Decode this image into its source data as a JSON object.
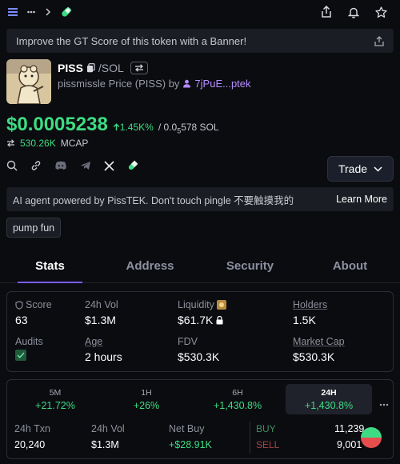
{
  "header": {
    "icons": [
      "menu-icon",
      "more-icon",
      "chevron-right-icon",
      "pill-icon",
      "share-icon",
      "bell-icon",
      "star-icon"
    ]
  },
  "banner": {
    "text": "Improve the GT Score of this token with a Banner!"
  },
  "token": {
    "symbol": "PISS",
    "pair": "/SOL",
    "subtitle": "pissmissle Price (PISS) by",
    "creator": "7jPuE...ptek"
  },
  "price": {
    "usd": "$0.0005238",
    "change": "1.45K%",
    "sol_prefix": "/ 0.0",
    "sol_sub": "5",
    "sol_rest": "578 SOL",
    "mcap_value": "530.26K",
    "mcap_label": "MCAP"
  },
  "actions": {
    "trade_label": "Trade"
  },
  "ai_bar": {
    "text": "AI agent powered by PissTEK. Don't touch pingle 不要触摸我的",
    "learn_more": "Learn More"
  },
  "tag": {
    "label": "pump fun"
  },
  "tabs": [
    {
      "label": "Stats"
    },
    {
      "label": "Address"
    },
    {
      "label": "Security"
    },
    {
      "label": "About"
    }
  ],
  "stats": {
    "score_label": "Score",
    "score_value": "63",
    "vol_label": "24h Vol",
    "vol_value": "$1.3M",
    "liquidity_label": "Liquidity",
    "liquidity_value": "$61.7K",
    "holders_label": "Holders",
    "holders_value": "1.5K",
    "audits_label": "Audits",
    "age_label": "Age",
    "age_value": "2 hours",
    "fdv_label": "FDV",
    "fdv_value": "$530.3K",
    "mcap_label": "Market Cap",
    "mcap_value": "$530.3K"
  },
  "performance": {
    "timeframes": [
      {
        "label": "5M",
        "change": "+21.72%"
      },
      {
        "label": "1H",
        "change": "+26%"
      },
      {
        "label": "6H",
        "change": "+1,430.8%"
      },
      {
        "label": "24H",
        "change": "+1,430.8%"
      }
    ],
    "txn_label": "24h Txn",
    "txn_value": "20,240",
    "vol_label": "24h Vol",
    "vol_value": "$1.3M",
    "netbuy_label": "Net Buy",
    "netbuy_value": "+$28.91K",
    "buy_label": "BUY",
    "buy_value": "11,239",
    "sell_label": "SELL",
    "sell_value": "9,001",
    "buy_color": "#3ddc84",
    "sell_color": "#e64d4d"
  }
}
